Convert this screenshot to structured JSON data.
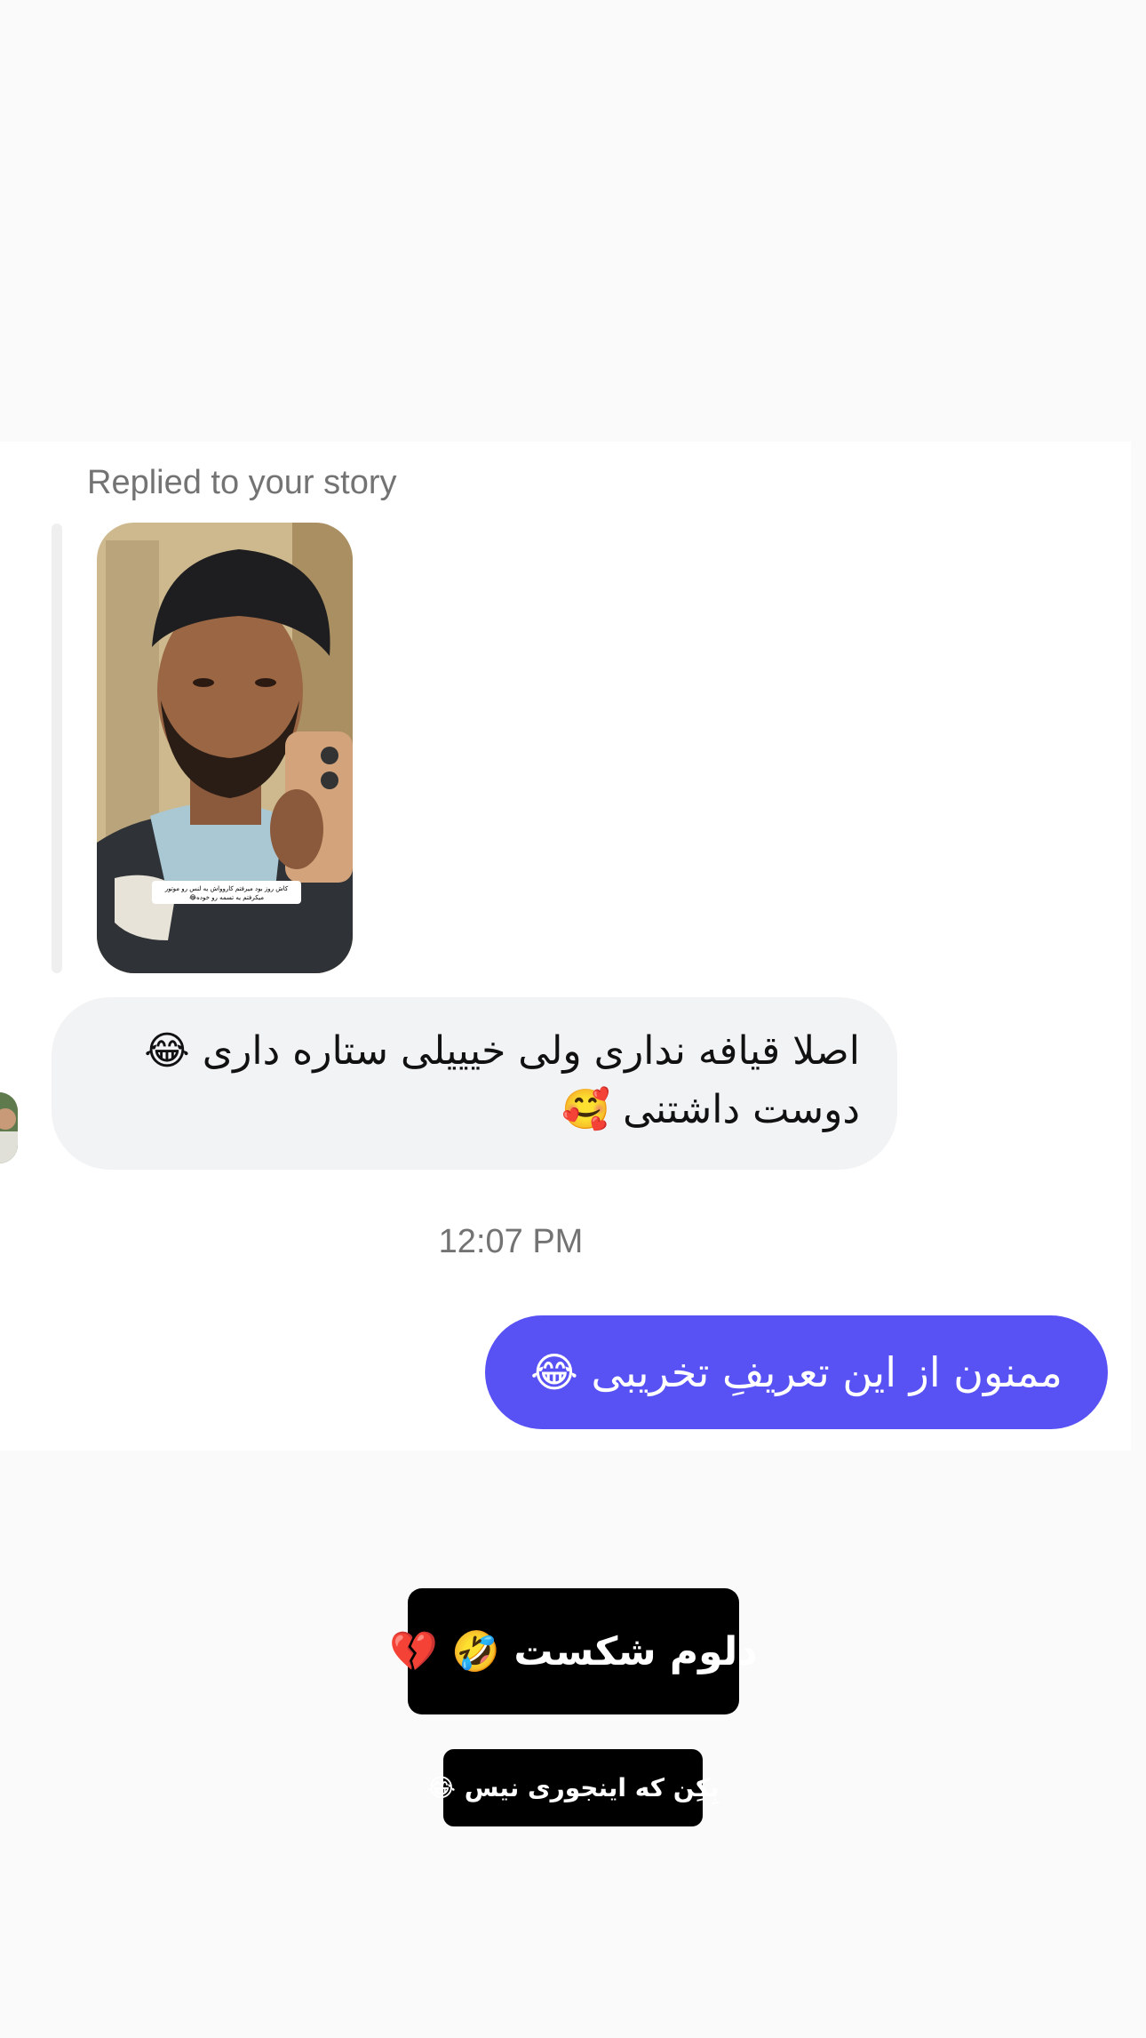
{
  "story_reply": {
    "label": "Replied to your story",
    "story_caption_line1": "کاش روز بود میرفتم کاروواش یه لنس رو موتور",
    "story_caption_line2": "میکرفتم یه تسمه رو خوده😂"
  },
  "messages": {
    "incoming": {
      "line1_text": "اصلا قیافه نداری ولی خیییلی ستاره داری",
      "line1_emoji": "😂",
      "line2_text": "دوست داشتنی",
      "line2_emoji": "🥰"
    },
    "timestamp": "12:07 PM",
    "outgoing": {
      "text": "ممنون از این تعریفِ تخریبی",
      "emoji": "😂"
    }
  },
  "stickers": {
    "big": {
      "text": "دلوم شکست",
      "emoji1": "🤣",
      "emoji2": "💔"
    },
    "small": {
      "text": "بِکِن که اینجوری نیس",
      "emoji": "😂"
    }
  },
  "colors": {
    "outgoing_bubble": "#5851f4",
    "incoming_bubble": "#f2f3f5",
    "sticker_bg": "#000000",
    "page_bg": "#fafafa",
    "card_bg": "#ffffff",
    "muted_text": "#737373"
  },
  "icons": {
    "avatar": "user-avatar",
    "story_thumbnail": "story-thumbnail"
  }
}
